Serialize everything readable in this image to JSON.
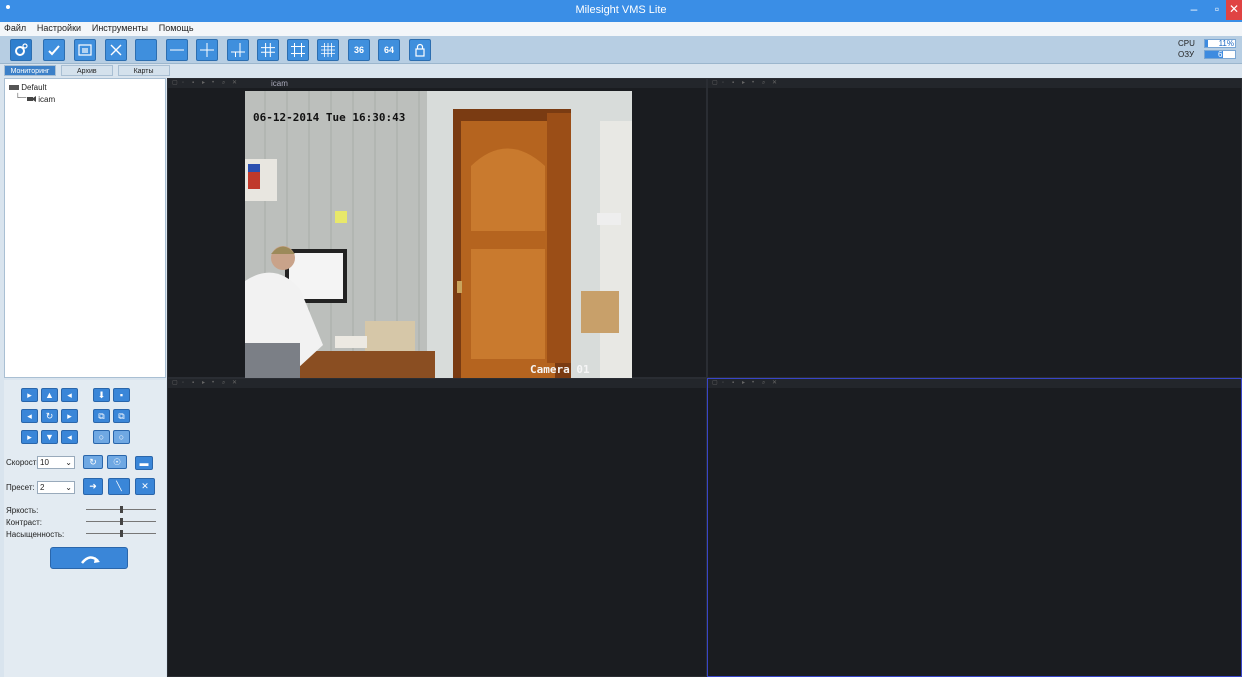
{
  "window": {
    "title": "Milesight VMS Lite",
    "minimize": "–",
    "maximize": "▫",
    "close": "✕"
  },
  "menu": [
    "Файл",
    "Настройки",
    "Инструменты",
    "Помощь"
  ],
  "toolbar": {
    "btn36": "36",
    "btn64": "64"
  },
  "stats": {
    "cpu_label": "CPU",
    "cpu_value": "11%",
    "cpu_percent": 11,
    "ram_label": "ОЗУ",
    "ram_value": "61%",
    "ram_percent": 61
  },
  "tabs": [
    "Мониторинг",
    "Архив",
    "Карты"
  ],
  "tree": {
    "root": "Default",
    "child": "icam"
  },
  "ptz": {
    "speed_label": "Скорость",
    "speed_value": "10",
    "preset_label": "Пресет:",
    "preset_value": "2",
    "brightness_label": "Яркость:",
    "contrast_label": "Контраст:",
    "saturation_label": "Насыщенность:",
    "brightness_level": 0.5,
    "contrast_level": 0.5,
    "saturation_level": 0.5
  },
  "cells": {
    "cell1": {
      "camera_name": "icam",
      "osd_datetime": "06-12-2014 Tue 16:30:43",
      "osd_camera": "Camera 01"
    }
  },
  "colors": {
    "accent": "#3a8ee6",
    "grid_bg": "#1a1c20",
    "selected_border": "#3845c8"
  }
}
